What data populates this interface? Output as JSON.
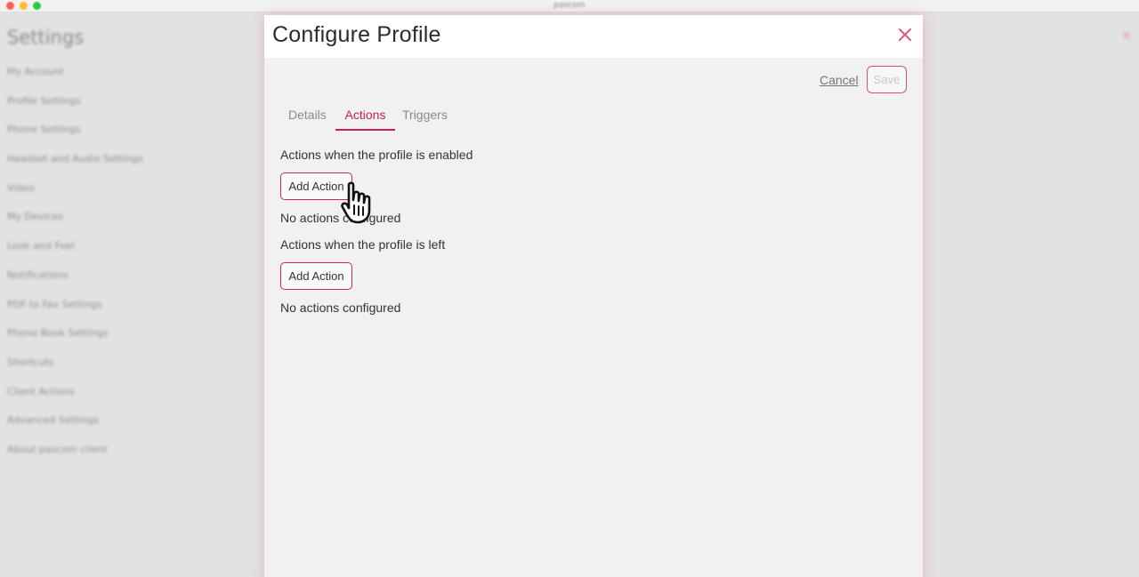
{
  "window": {
    "title": "pascom"
  },
  "background": {
    "heading": "Settings",
    "nav_items": [
      "My Account",
      "Profile Settings",
      "Phone Settings",
      "Headset and Audio Settings",
      "Video",
      "My Devices",
      "Look and Feel",
      "Notifications",
      "PDF to Fax Settings",
      "Phone Book Settings",
      "Shortcuts",
      "Client Actions",
      "Advanced Settings",
      "About pascom client"
    ],
    "close_glyph": "×"
  },
  "modal": {
    "title": "Configure Profile",
    "close_icon": "close-icon",
    "cancel_label": "Cancel",
    "save_label": "Save",
    "tabs": [
      {
        "label": "Details",
        "active": false
      },
      {
        "label": "Actions",
        "active": true
      },
      {
        "label": "Triggers",
        "active": false
      }
    ],
    "sections": [
      {
        "label": "Actions when the profile is enabled",
        "button_label": "Add Action",
        "empty_text": "No actions configured"
      },
      {
        "label": "Actions when the profile is left",
        "button_label": "Add Action",
        "empty_text": "No actions configured"
      }
    ]
  },
  "colors": {
    "accent": "#c7204e",
    "modal_bg": "#f1f1f1",
    "header_bg": "#ffffff"
  },
  "cursor": {
    "icon": "hand-pointer-icon"
  }
}
